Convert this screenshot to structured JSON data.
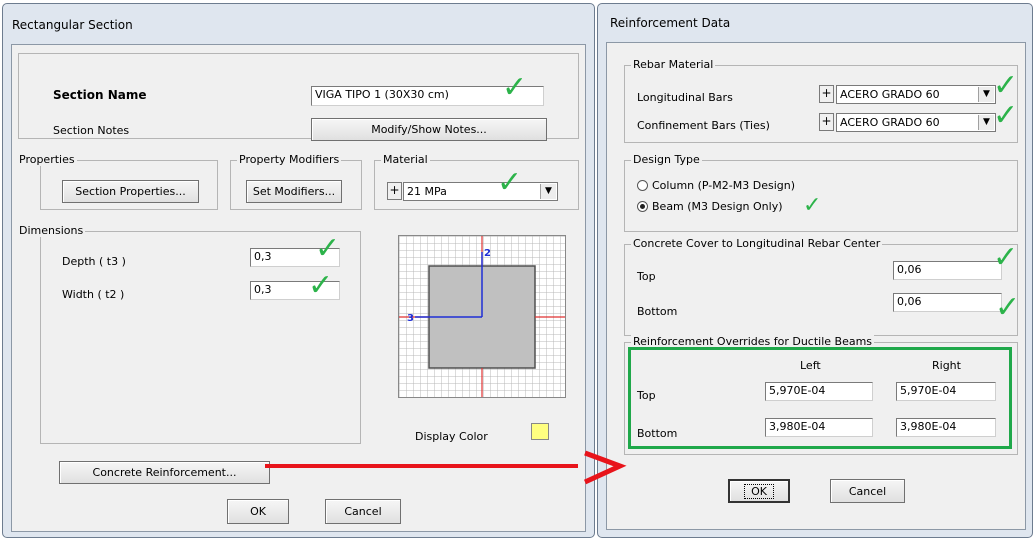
{
  "left_dialog": {
    "title": "Rectangular Section",
    "section_name_label": "Section Name",
    "section_name_value": "VIGA TIPO 1 (30X30 cm)",
    "section_notes_label": "Section Notes",
    "modify_notes_button": "Modify/Show Notes...",
    "properties_group": "Properties",
    "section_properties_button": "Section Properties...",
    "property_modifiers_group": "Property Modifiers",
    "set_modifiers_button": "Set Modifiers...",
    "material_group": "Material",
    "material_plus": "+",
    "material_value": "21 MPa",
    "dimensions_group": "Dimensions",
    "depth_label": "Depth ( t3 )",
    "depth_value": "0,3",
    "width_label": "Width ( t2 )",
    "width_value": "0,3",
    "axis_2_label": "2",
    "axis_3_label": "3",
    "display_color_label": "Display Color",
    "display_color": "#ffff80",
    "concrete_reinforcement_button": "Concrete Reinforcement...",
    "ok_button": "OK",
    "cancel_button": "Cancel"
  },
  "right_dialog": {
    "title": "Reinforcement Data",
    "rebar_material_group": "Rebar Material",
    "longitudinal_bars_label": "Longitudinal Bars",
    "longitudinal_bars_plus": "+",
    "longitudinal_bars_value": "ACERO GRADO 60",
    "confinement_bars_label": "Confinement Bars (Ties)",
    "confinement_bars_plus": "+",
    "confinement_bars_value": "ACERO GRADO 60",
    "design_type_group": "Design Type",
    "column_option": "Column  (P-M2-M3 Design)",
    "beam_option": "Beam  (M3 Design Only)",
    "selected_design_type": "beam",
    "concrete_cover_group": "Concrete Cover to Longitudinal Rebar Center",
    "cover_top_label": "Top",
    "cover_top_value": "0,06",
    "cover_bottom_label": "Bottom",
    "cover_bottom_value": "0,06",
    "overrides_group": "Reinforcement Overrides for Ductile Beams",
    "col_left": "Left",
    "col_right": "Right",
    "row_top": "Top",
    "row_bottom": "Bottom",
    "top_left": "5,970E-04",
    "top_right": "5,970E-04",
    "bottom_left": "3,980E-04",
    "bottom_right": "3,980E-04",
    "ok_button": "OK",
    "cancel_button": "Cancel"
  },
  "annotations": {
    "checkmark_glyph": "✓",
    "checkmark_color": "#2cb34a",
    "arrow_color": "#e8141b",
    "highlight_box_color": "#1fa84a"
  }
}
